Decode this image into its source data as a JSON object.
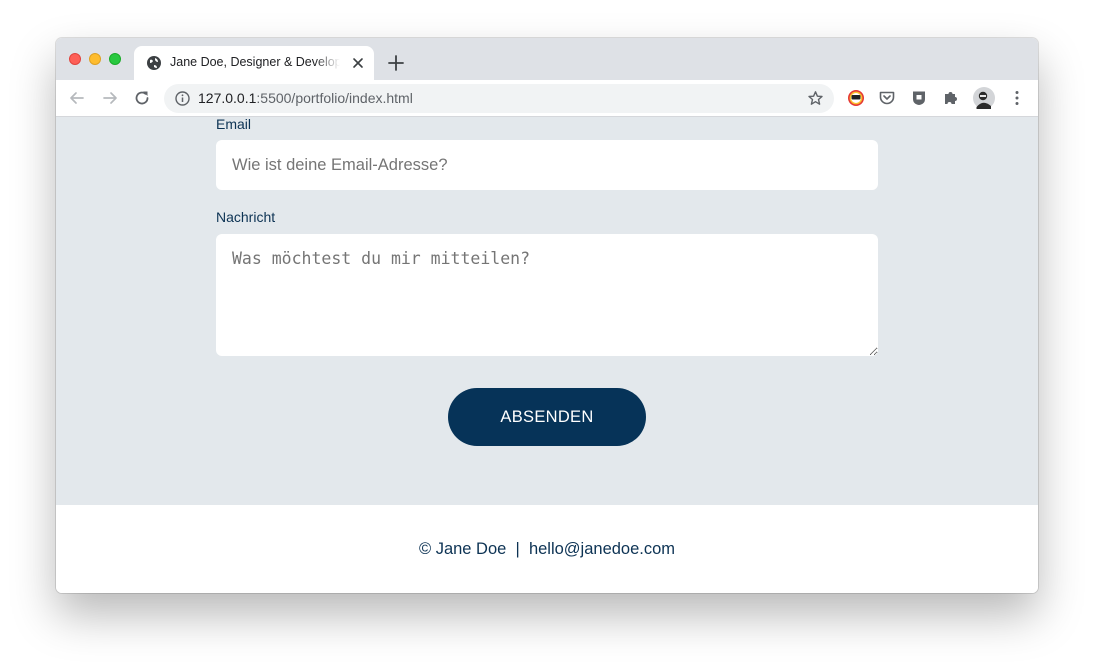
{
  "tab": {
    "title": "Jane Doe, Designer & Developer",
    "close_icon": "close-icon",
    "favicon": "globe-icon"
  },
  "toolbar": {
    "url_host": "127.0.0.1",
    "url_rest": ":5500/portfolio/index.html",
    "icons": [
      "back-arrow-icon",
      "forward-arrow-icon",
      "reload-icon",
      "info-icon",
      "star-icon",
      "extension-color-icon",
      "pocket-icon",
      "shield-icon",
      "puzzle-icon",
      "profile-avatar",
      "kebab-menu-icon"
    ]
  },
  "form": {
    "email_label": "Email",
    "email_placeholder": "Wie ist deine Email-Adresse?",
    "message_label": "Nachricht",
    "message_placeholder": "Was möchtest du mir mitteilen?",
    "submit_label": "ABSENDEN"
  },
  "footer": {
    "text": "© Jane Doe  |  hello@janedoe.com"
  },
  "colors": {
    "form_background": "#e3e8ec",
    "accent": "#063358",
    "label_text": "#0d3354",
    "placeholder_text": "#7d93a6"
  }
}
